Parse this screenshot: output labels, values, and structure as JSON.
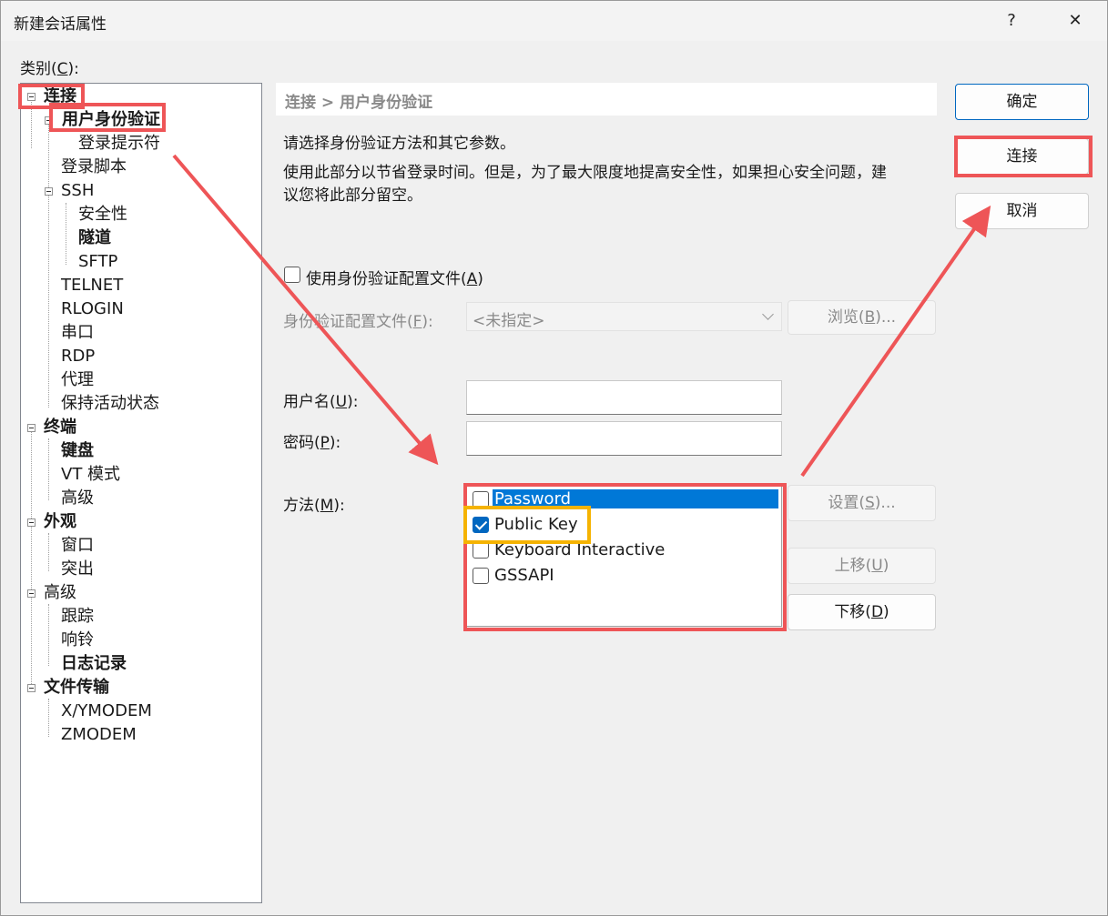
{
  "window": {
    "title": "新建会话属性",
    "help_label": "?",
    "close_label": "✕"
  },
  "category_label": {
    "pre": "类别(",
    "key": "C",
    "post": "):"
  },
  "tree": [
    {
      "label": "连接",
      "bold": true
    },
    {
      "label": "用户身份验证",
      "bold": true
    },
    {
      "label": "登录提示符",
      "bold": false
    },
    {
      "label": "登录脚本",
      "bold": false
    },
    {
      "label": "SSH",
      "bold": false
    },
    {
      "label": "安全性",
      "bold": false
    },
    {
      "label": "隧道",
      "bold": true
    },
    {
      "label": "SFTP",
      "bold": false
    },
    {
      "label": "TELNET",
      "bold": false
    },
    {
      "label": "RLOGIN",
      "bold": false
    },
    {
      "label": "串口",
      "bold": false
    },
    {
      "label": "RDP",
      "bold": false
    },
    {
      "label": "代理",
      "bold": false
    },
    {
      "label": "保持活动状态",
      "bold": false
    },
    {
      "label": "终端",
      "bold": true
    },
    {
      "label": "键盘",
      "bold": true
    },
    {
      "label": "VT 模式",
      "bold": false
    },
    {
      "label": "高级",
      "bold": false
    },
    {
      "label": "外观",
      "bold": true
    },
    {
      "label": "窗口",
      "bold": false
    },
    {
      "label": "突出",
      "bold": false
    },
    {
      "label": "高级",
      "bold": false
    },
    {
      "label": "跟踪",
      "bold": false
    },
    {
      "label": "响铃",
      "bold": false
    },
    {
      "label": "日志记录",
      "bold": true
    },
    {
      "label": "文件传输",
      "bold": true
    },
    {
      "label": "X/YMODEM",
      "bold": false
    },
    {
      "label": "ZMODEM",
      "bold": false
    }
  ],
  "breadcrumb": "连接 > 用户身份验证",
  "desc1": "请选择身份验证方法和其它参数。",
  "desc2a": "使用此部分以节省登录时间。但是，为了最大限度地提高安全性，如果担心安全问题，建",
  "desc2b": "议您将此部分留空。",
  "use_profile": {
    "pre": "使用身份验证配置文件(",
    "key": "A",
    "post": ")",
    "checked": false
  },
  "profile_label": {
    "pre": "身份验证配置文件(",
    "key": "F",
    "post": "):"
  },
  "profile_value": "<未指定>",
  "browse": {
    "pre": "浏览(",
    "key": "B",
    "post": ")..."
  },
  "username_label": {
    "pre": "用户名(",
    "key": "U",
    "post": "):"
  },
  "username_value": "",
  "password_label": {
    "pre": "密码(",
    "key": "P",
    "post": "):"
  },
  "password_value": "",
  "method_label": {
    "pre": "方法(",
    "key": "M",
    "post": "):"
  },
  "methods": [
    {
      "label": "Password",
      "checked": false,
      "selected": true
    },
    {
      "label": "Public Key",
      "checked": true,
      "selected": false
    },
    {
      "label": "Keyboard Interactive",
      "checked": false,
      "selected": false
    },
    {
      "label": "GSSAPI",
      "checked": false,
      "selected": false
    }
  ],
  "settings_btn": {
    "pre": "设置(",
    "key": "S",
    "post": ")..."
  },
  "move_up_btn": {
    "pre": "上移(",
    "key": "U",
    "post": ")"
  },
  "move_down_btn": {
    "pre": "下移(",
    "key": "D",
    "post": ")"
  },
  "ok_btn": "确定",
  "connect_btn": "连接",
  "cancel_btn": "取消",
  "colors": {
    "annotation_red": "#ee5557",
    "annotation_yellow": "#f5b301",
    "accent": "#0067c0",
    "selection": "#0078d7"
  }
}
